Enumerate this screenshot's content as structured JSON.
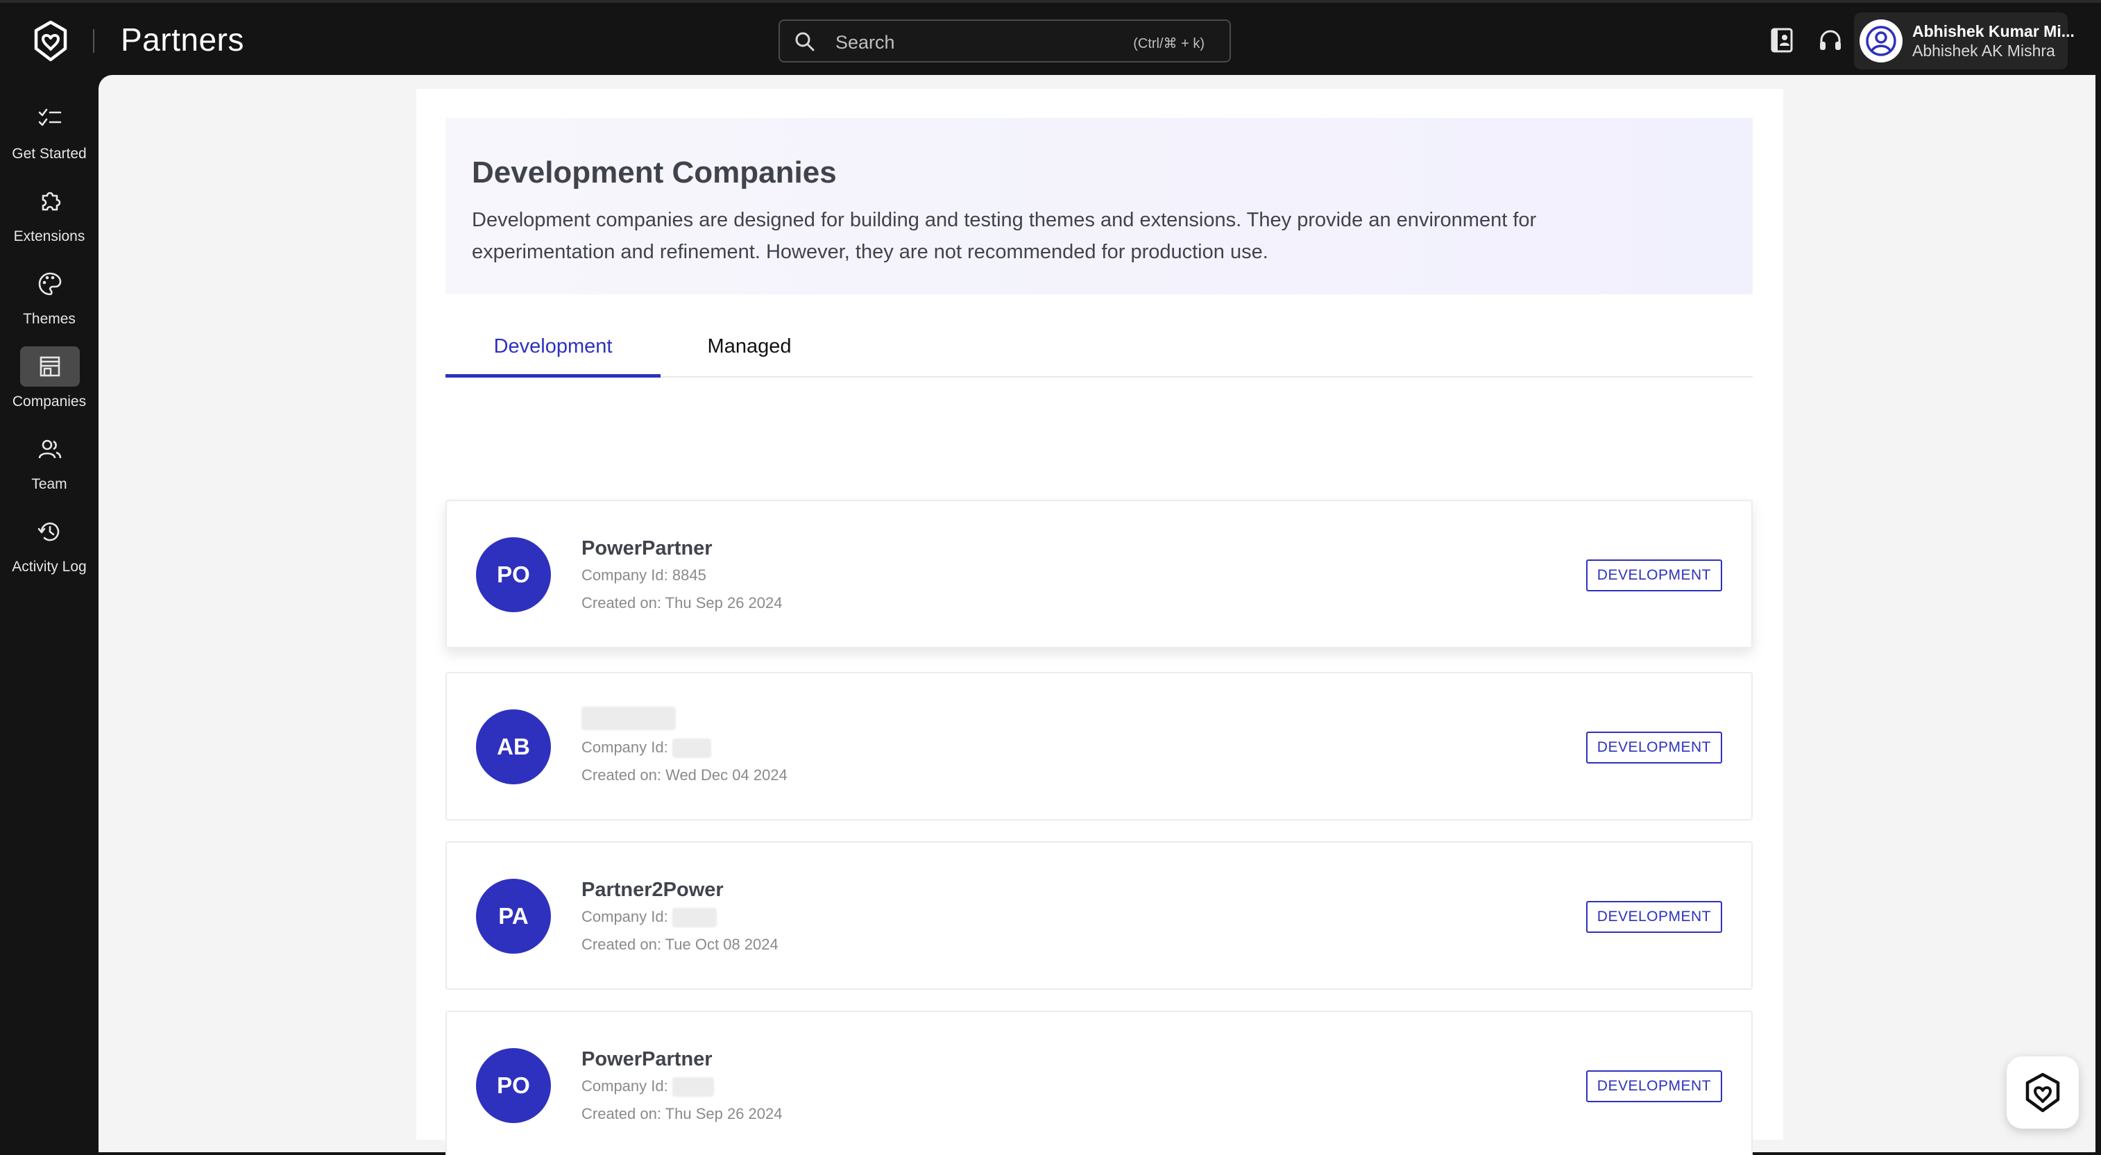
{
  "app": {
    "title": "Partners"
  },
  "search": {
    "placeholder": "Search",
    "shortcut": "(Ctrl/⌘ + k)"
  },
  "user": {
    "name": "Abhishek Kumar Mi...",
    "org": "Abhishek AK Mishra"
  },
  "sidebar": {
    "items": [
      {
        "label": "Get Started",
        "icon": "checklist-icon"
      },
      {
        "label": "Extensions",
        "icon": "puzzle-icon"
      },
      {
        "label": "Themes",
        "icon": "palette-icon"
      },
      {
        "label": "Companies",
        "icon": "store-icon",
        "active": true
      },
      {
        "label": "Team",
        "icon": "team-icon"
      },
      {
        "label": "Activity Log",
        "icon": "history-icon"
      }
    ]
  },
  "banner": {
    "title": "Development Companies",
    "description": "Development companies are designed for building and testing themes and extensions. They provide an environment for experimentation and refinement. However, they are not recommended for production use."
  },
  "tabs": [
    {
      "label": "Development",
      "active": true
    },
    {
      "label": "Managed",
      "active": false
    }
  ],
  "companies": [
    {
      "initials": "PO",
      "name": "PowerPartner",
      "id_label": "Company Id:",
      "id_value": "8845",
      "created": "Created on: Thu Sep 26 2024",
      "badge": "DEVELOPMENT"
    },
    {
      "initials": "AB",
      "name": "",
      "id_label": "Company Id:",
      "id_value": "",
      "created": "Created on: Wed Dec 04 2024",
      "badge": "DEVELOPMENT"
    },
    {
      "initials": "PA",
      "name": "Partner2Power",
      "id_label": "Company Id:",
      "id_value": "",
      "created": "Created on: Tue Oct 08 2024",
      "badge": "DEVELOPMENT"
    },
    {
      "initials": "PO",
      "name": "PowerPartner",
      "id_label": "Company Id:",
      "id_value": "",
      "created": "Created on: Thu Sep 26 2024",
      "badge": "DEVELOPMENT"
    }
  ],
  "colors": {
    "accent": "#2e31be",
    "topbar": "#141414",
    "banner": "#f1f0fd"
  }
}
